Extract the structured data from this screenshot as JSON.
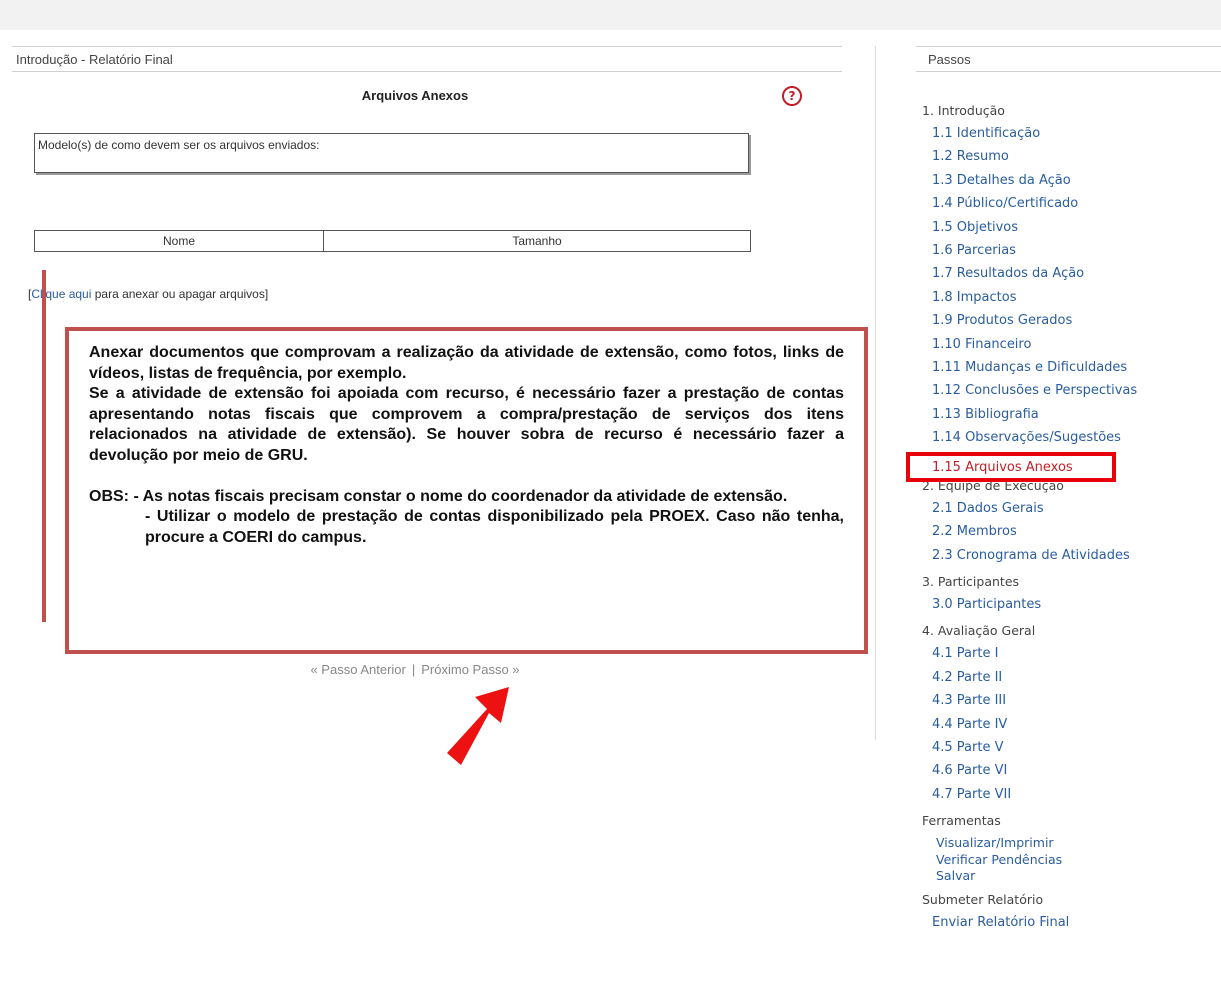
{
  "main": {
    "header": "Introdução - Relatório Final",
    "section_title": "Arquivos Anexos",
    "help_icon": "?",
    "model_label": "Modelo(s) de como devem ser os arquivos enviados:",
    "table": {
      "col_name": "Nome",
      "col_size": "Tamanho"
    },
    "attach": {
      "open": "[",
      "link": "Clique aqui",
      "rest": " para anexar ou apagar arquivos]"
    },
    "pager": {
      "prev": "« Passo Anterior",
      "sep": "|",
      "next": "Próximo Passo »"
    }
  },
  "note": {
    "p1": "Anexar documentos que comprovam a realização da atividade de extensão, como fotos, links de vídeos, listas de frequência, por exemplo.",
    "p2": "Se a atividade de extensão foi apoiada com recurso, é necessário fazer a prestação de contas apresentando notas fiscais que comprovem a compra/prestação de serviços dos itens relacionados na atividade de extensão). Se houver sobra de recurso é necessário fazer a devolução por meio de GRU.",
    "p3": "OBS: - As notas fiscais precisam constar o nome do coordenador da atividade de extensão.",
    "p4": "- Utilizar o modelo de prestação de contas disponibilizado pela PROEX. Caso não tenha, procure a COERI do campus."
  },
  "sidebar": {
    "header": "Passos",
    "groups": [
      {
        "label": "1. Introdução",
        "items": [
          "1.1 Identificação",
          "1.2 Resumo",
          "1.3 Detalhes da Ação",
          "1.4 Público/Certificado",
          "1.5 Objetivos",
          "1.6 Parcerias",
          "1.7 Resultados da Ação",
          "1.8 Impactos",
          "1.9 Produtos Gerados",
          "1.10 Financeiro",
          "1.11 Mudanças e Dificuldades",
          "1.12 Conclusões e Perspectivas",
          "1.13 Bibliografia",
          "1.14 Observações/Sugestões",
          "1.15 Arquivos Anexos"
        ]
      },
      {
        "label": "2. Equipe de Execução",
        "items": [
          "2.1 Dados Gerais",
          "2.2 Membros",
          "2.3 Cronograma de Atividades"
        ]
      },
      {
        "label": "3. Participantes",
        "items": [
          "3.0 Participantes"
        ]
      },
      {
        "label": "4. Avaliação Geral",
        "items": [
          "4.1 Parte I",
          "4.2 Parte II",
          "4.3 Parte III",
          "4.4 Parte IV",
          "4.5 Parte V",
          "4.6 Parte VI",
          "4.7 Parte VII"
        ]
      }
    ],
    "tools_label": "Ferramentas",
    "tools": [
      "Visualizar/Imprimir",
      "Verificar Pendências",
      "Salvar"
    ],
    "submit_label": "Submeter Relatório",
    "submit_item": "Enviar Relatório Final",
    "active_item": "1.15 Arquivos Anexos"
  },
  "colors": {
    "link": "#2a5d9f",
    "accent_red": "#c0202a",
    "annotation_red": "#e8000b",
    "box_border": "#c0504d"
  },
  "icons": {
    "help": "help-circle-icon",
    "arrow": "red-arrow-icon"
  }
}
